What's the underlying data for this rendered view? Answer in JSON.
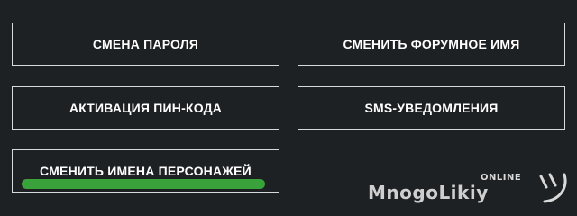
{
  "buttons": {
    "change_password": "СМЕНА ПАРОЛЯ",
    "change_forum_name": "СМЕНИТЬ ФОРУМНОЕ ИМЯ",
    "pin_activation": "АКТИВАЦИЯ ПИН-КОДА",
    "sms_notifications": "SMS-УВЕДОМЛЕНИЯ",
    "change_character_names": "СМЕНИТЬ ИМЕНА ПЕРСОНАЖЕЙ"
  },
  "watermark": {
    "online": "ONLINE",
    "brand": "MnogoLikiy",
    "icon": "smile-icon"
  },
  "colors": {
    "background": "#1e2124",
    "border": "#d9d9d9",
    "highlight": "#3aa23a",
    "text": "#ffffff"
  }
}
